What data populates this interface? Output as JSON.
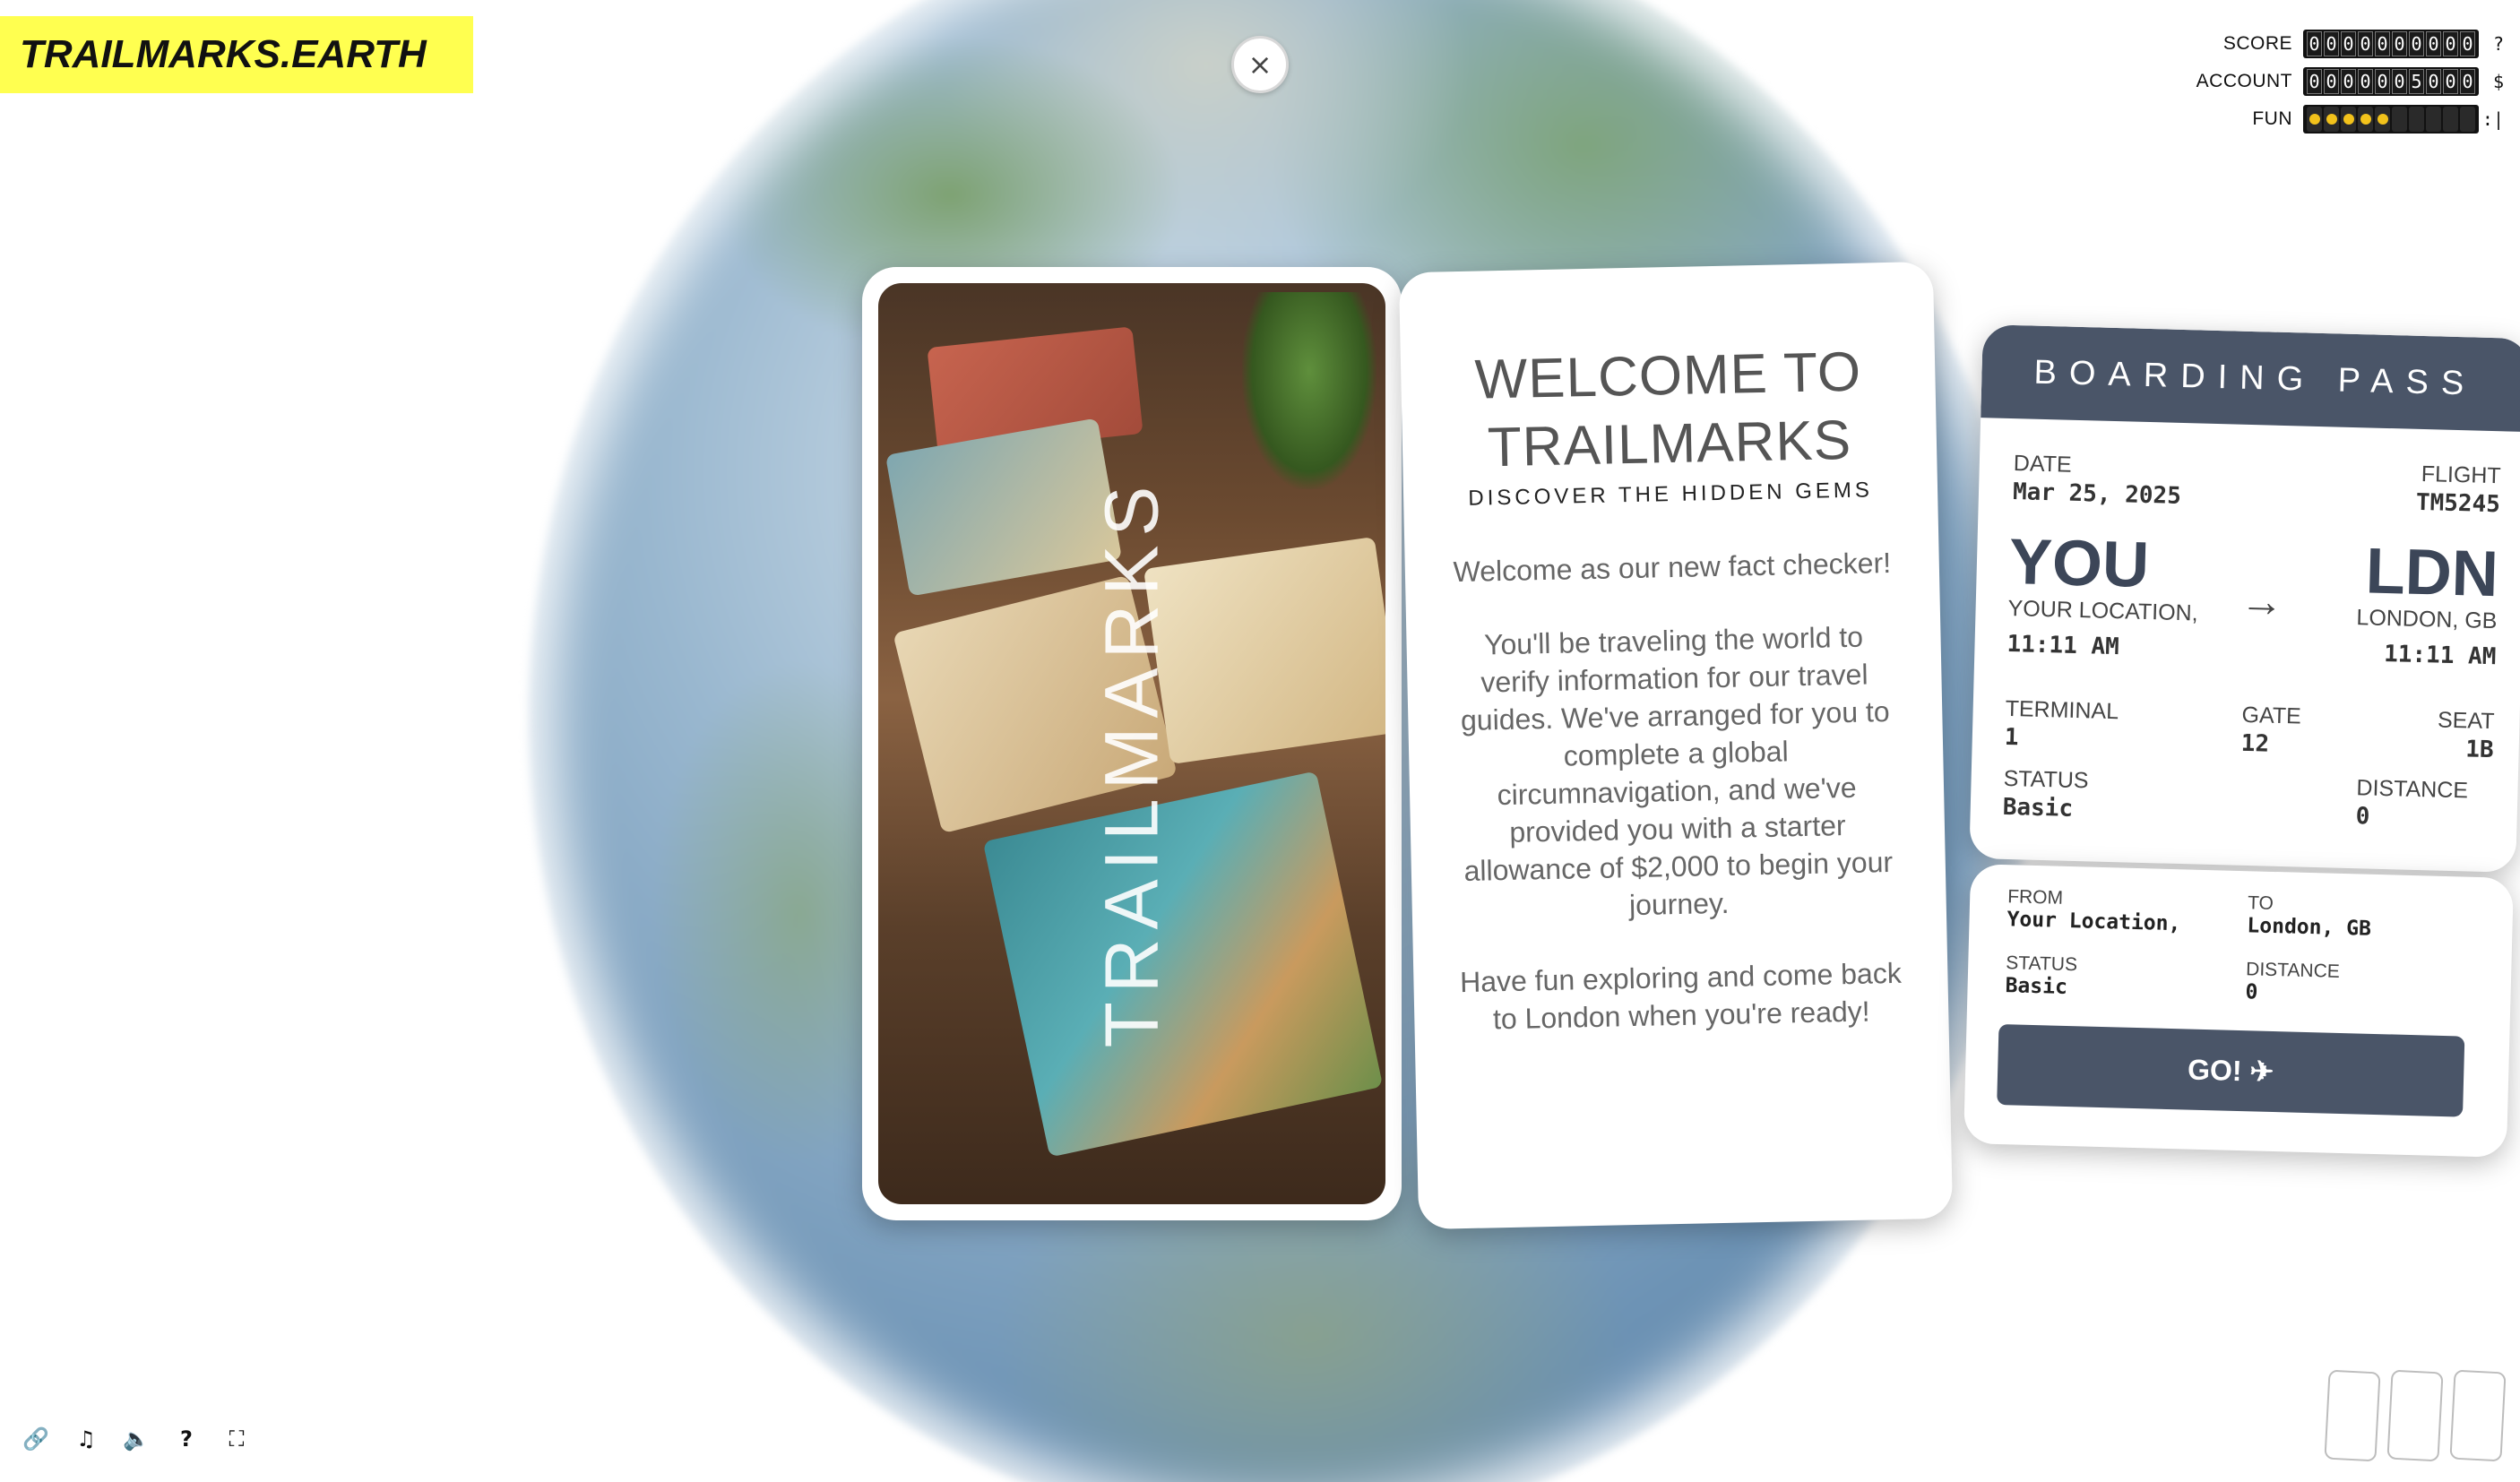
{
  "brand": {
    "name": "TRAILMARKS.EARTH"
  },
  "close": {
    "symbol": "×"
  },
  "stats": {
    "score": {
      "label": "SCORE",
      "digits": "0000000000",
      "suffix": "?"
    },
    "account": {
      "label": "ACCOUNT",
      "digits": "0000005000",
      "suffix": "$"
    },
    "fun": {
      "label": "FUN",
      "level": 5,
      "max": 10,
      "suffix": ":|"
    }
  },
  "photo": {
    "overlay_text": "TRAILMARKS"
  },
  "welcome": {
    "title_line1": "WELCOME TO",
    "title_line2": "TRAILMARKS",
    "subtitle": "DISCOVER THE HIDDEN GEMS",
    "paragraph1": "Welcome as our new fact checker!",
    "paragraph2": "You'll be traveling the world to verify information for our travel guides. We've arranged for you to complete a global circumnavigation, and we've provided you with a starter allowance of $2,000 to begin your journey.",
    "paragraph3": "Have fun exploring and come back to London when you're ready!"
  },
  "boarding_pass": {
    "header": "BOARDING PASS",
    "date_label": "DATE",
    "date": "Mar 25, 2025",
    "flight_label": "FLIGHT",
    "flight": "TM5245",
    "origin_code": "YOU",
    "origin_name": "YOUR LOCATION,",
    "origin_time": "11:11 AM",
    "arrow": "→",
    "dest_code": "LDN",
    "dest_name": "LONDON, GB",
    "dest_time": "11:11 AM",
    "terminal_label": "TERMINAL",
    "terminal": "1",
    "gate_label": "GATE",
    "gate": "12",
    "seat_label": "SEAT",
    "seat": "1B",
    "status_label": "STATUS",
    "status": "Basic",
    "distance_label": "DISTANCE",
    "distance": "0"
  },
  "ticket": {
    "from_label": "FROM",
    "from": "Your Location,",
    "to_label": "TO",
    "to": "London, GB",
    "status_label": "STATUS",
    "status": "Basic",
    "distance_label": "DISTANCE",
    "distance": "0",
    "go_label": "GO! ✈"
  },
  "controls": {
    "link": "🔗",
    "music": "♫",
    "sound": "🔈",
    "help": "?",
    "fullscreen": "⛶"
  }
}
